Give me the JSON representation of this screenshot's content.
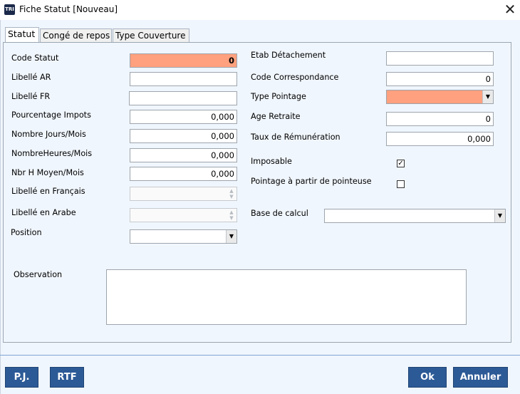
{
  "window": {
    "title": "Fiche Statut [Nouveau]",
    "app_icon": "TRI"
  },
  "tabs": [
    {
      "label": "Statut"
    },
    {
      "label": "Congé de repos"
    },
    {
      "label": "Type Couverture"
    }
  ],
  "left": {
    "code_statut": {
      "label": "Code Statut",
      "value": "0"
    },
    "libelle_ar": {
      "label": "Libellé AR",
      "value": ""
    },
    "libelle_fr": {
      "label": "Libellé FR",
      "value": ""
    },
    "pourcentage_impots": {
      "label": "Pourcentage Impots",
      "value": "0,000"
    },
    "nombre_jours": {
      "label": "Nombre Jours/Mois",
      "value": "0,000"
    },
    "nombre_heures": {
      "label": "NombreHeures/Mois",
      "value": "0,000"
    },
    "nbr_h_moyen": {
      "label": "Nbr H Moyen/Mois",
      "value": "0,000"
    },
    "libelle_francais": {
      "label": "Libellé en Français",
      "value": ""
    },
    "libelle_arabe": {
      "label": "Libellé en Arabe",
      "value": ""
    },
    "position": {
      "label": "Position",
      "value": ""
    }
  },
  "right": {
    "etab_detachement": {
      "label": "Etab Détachement",
      "value": ""
    },
    "code_correspondance": {
      "label": "Code Correspondance",
      "value": "0"
    },
    "type_pointage": {
      "label": "Type Pointage",
      "value": ""
    },
    "age_retraite": {
      "label": "Age Retraite",
      "value": "0"
    },
    "taux_remuneration": {
      "label": "Taux de Rémunération",
      "value": "0,000"
    },
    "imposable": {
      "label": "Imposable",
      "checked": true,
      "mark": "✓"
    },
    "pointage_pointeuse": {
      "label": "Pointage à partir de pointeuse",
      "checked": false,
      "mark": ""
    },
    "base_calcul": {
      "label": "Base de calcul",
      "value": ""
    }
  },
  "observation": {
    "label": "Observation",
    "value": ""
  },
  "buttons": {
    "pj": "P.J.",
    "rtf": "RTF",
    "ok": "Ok",
    "annuler": "Annuler"
  },
  "colors": {
    "required_field": "#ffa07e",
    "button": "#2c5a96",
    "panel": "#f0f6fd"
  }
}
